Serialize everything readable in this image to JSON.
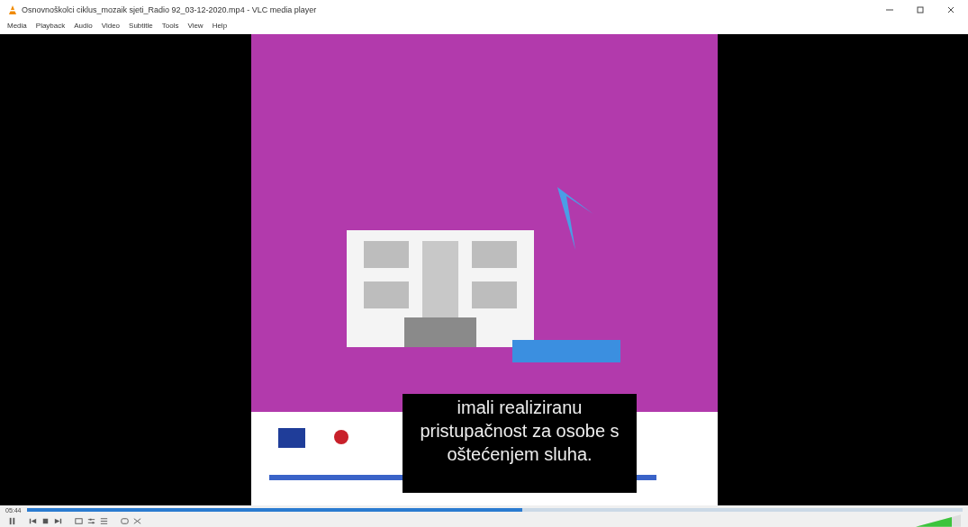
{
  "window": {
    "title": "Osnovnoškolci ciklus_mozaik sjeti_Radio 92_03-12-2020.mp4 - VLC media player"
  },
  "menu": [
    "Media",
    "Playback",
    "Audio",
    "Video",
    "Subtitle",
    "Tools",
    "View",
    "Help"
  ],
  "video": {
    "kind": "picture",
    "subtitle": "imali realiziranu pristupačnost za osobe s oštećenjem sluha."
  },
  "seek": {
    "elapsed": "05:44",
    "level": 0.53
  },
  "volume": {
    "level": 0.8
  }
}
